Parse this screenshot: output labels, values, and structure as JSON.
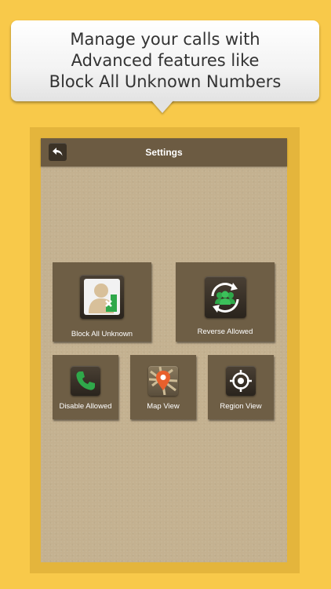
{
  "promo": {
    "lines": [
      "Manage your calls with",
      "Advanced features like",
      "Block All Unknown Numbers"
    ]
  },
  "navbar": {
    "title": "Settings",
    "back_icon": "back-arrow-icon"
  },
  "tiles": [
    {
      "label": "Block All Unknown",
      "icon": "person-block-icon"
    },
    {
      "label": "Reverse Allowed",
      "icon": "reverse-group-icon"
    },
    {
      "label": "Disable Allowed",
      "icon": "phone-icon"
    },
    {
      "label": "Map View",
      "icon": "map-pin-icon"
    },
    {
      "label": "Region View",
      "icon": "crosshair-icon"
    }
  ],
  "colors": {
    "background": "#f8c94a",
    "frame": "#e4b53c",
    "screen": "#c4b190",
    "navbar": "#6c5b42",
    "tile": "#6e5e45",
    "accent_green": "#2fa84a",
    "pin_orange": "#e8602c"
  }
}
